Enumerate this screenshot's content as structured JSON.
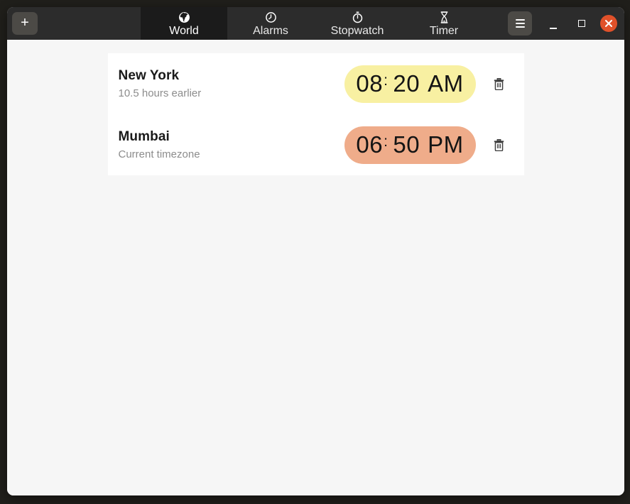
{
  "header": {
    "add_button_label": "+",
    "tabs": [
      {
        "label": "World",
        "icon": "globe-icon",
        "active": true
      },
      {
        "label": "Alarms",
        "icon": "alarm-icon",
        "active": false
      },
      {
        "label": "Stopwatch",
        "icon": "stopwatch-icon",
        "active": false
      },
      {
        "label": "Timer",
        "icon": "hourglass-icon",
        "active": false
      }
    ]
  },
  "world_clocks": [
    {
      "city": "New York",
      "offset_label": "10.5 hours earlier",
      "time": {
        "hours": "08",
        "separator": ":",
        "minutes": "20",
        "period": "AM"
      },
      "pill_color": "#f8f0a2"
    },
    {
      "city": "Mumbai",
      "offset_label": "Current timezone",
      "time": {
        "hours": "06",
        "separator": ":",
        "minutes": "50",
        "period": "PM"
      },
      "pill_color": "#efac8a"
    }
  ],
  "colors": {
    "desktop_bg": "#201f1b",
    "headerbar_bg": "#2c2c2c",
    "active_tab_bg": "#1b1b1b",
    "header_button_bg": "#4c4a46",
    "content_bg": "#f6f6f6",
    "card_bg": "#ffffff",
    "close_button_bg": "#e0512a",
    "yellow_pill": "#f8f0a2",
    "salmon_pill": "#efac8a"
  }
}
